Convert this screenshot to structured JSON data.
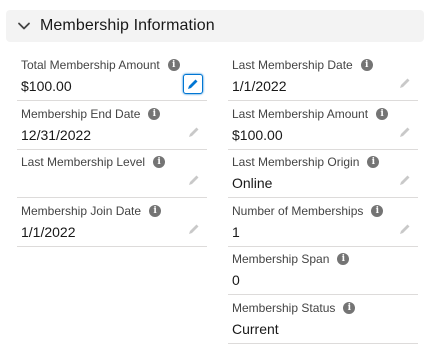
{
  "section": {
    "title": "Membership Information"
  },
  "left_fields": [
    {
      "label": "Total Membership Amount",
      "value": "$100.00"
    },
    {
      "label": "Membership End Date",
      "value": "12/31/2022"
    },
    {
      "label": "Last Membership Level",
      "value": ""
    },
    {
      "label": "Membership Join Date",
      "value": "1/1/2022"
    }
  ],
  "right_fields": [
    {
      "label": "Last Membership Date",
      "value": "1/1/2022"
    },
    {
      "label": "Last Membership Amount",
      "value": "$100.00"
    },
    {
      "label": "Last Membership Origin",
      "value": "Online"
    },
    {
      "label": "Number of Memberships",
      "value": "1"
    },
    {
      "label": "Membership Span",
      "value": "0"
    },
    {
      "label": "Membership Status",
      "value": "Current"
    }
  ],
  "icons": {
    "section_toggle": "chevron-down-icon",
    "help": "info-icon",
    "edit": "pencil-icon"
  },
  "colors": {
    "header_bg": "#f3f3f3",
    "brand_blue": "#0176d3",
    "info_icon": "#747474",
    "edit_icon_muted": "#c9c9c9"
  }
}
